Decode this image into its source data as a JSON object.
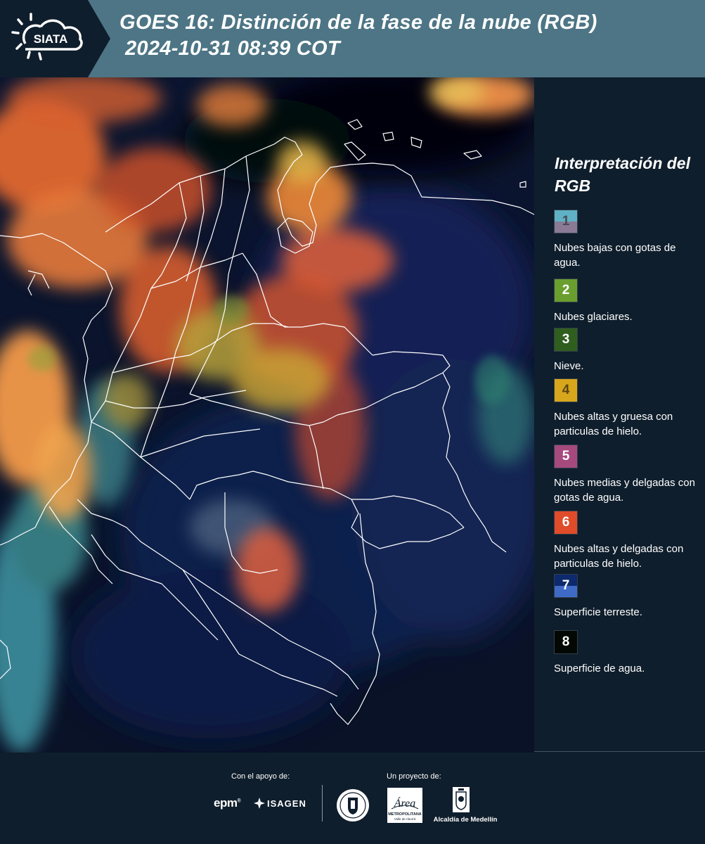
{
  "header": {
    "logo_text": "SIATA",
    "title_line1": "GOES 16: Distinción de la fase de la nube (RGB)",
    "title_line2": "2024-10-31 08:39 COT",
    "colors": {
      "bar": "#4d7585",
      "logo_bg": "#0f1e2c"
    }
  },
  "map": {
    "colors": {
      "ocean": "#0a1428",
      "borders": "#ffffff"
    }
  },
  "legend": {
    "title": "Interpretación del RGB",
    "items": [
      {
        "num": "1",
        "label": "Nubes bajas con gotas de agua.",
        "color_top": "#5fb2c5",
        "color_bottom": "#8a7a95",
        "num_color": "#4a4a55"
      },
      {
        "num": "2",
        "label": "Nubes glaciares.",
        "color_top": "#6a9e2e",
        "color_bottom": "#6a9e2e",
        "num_color": "#ffffff"
      },
      {
        "num": "3",
        "label": "Nieve.",
        "color_top": "#2f5e1f",
        "color_bottom": "#2f5e1f",
        "num_color": "#ffffff"
      },
      {
        "num": "4",
        "label": "Nubes altas y gruesa con particulas de hielo.",
        "color_top": "#d8a61d",
        "color_bottom": "#d8a61d",
        "num_color": "#5a4510"
      },
      {
        "num": "5",
        "label": "Nubes medias y delgadas con gotas de agua.",
        "color_top": "#a64a7e",
        "color_bottom": "#a64a7e",
        "num_color": "#ffffff"
      },
      {
        "num": "6",
        "label": "Nubes altas y delgadas con particulas de hielo.",
        "color_top": "#e04b2a",
        "color_bottom": "#e04b2a",
        "num_color": "#ffffff"
      },
      {
        "num": "7",
        "label": "Superficie terreste.",
        "color_top": "#0d2a6e",
        "color_bottom": "#3f6bc7",
        "num_color": "#ffffff"
      },
      {
        "num": "8",
        "label": "Superficie de agua.",
        "color_top": "#030805",
        "color_bottom": "#030805",
        "num_color": "#ffffff"
      }
    ]
  },
  "footer": {
    "support_label": "Con el apoyo de:",
    "project_label": "Un proyecto de:",
    "epm_logo": "epm",
    "isagen_logo": "ISAGEN",
    "amva_logo": "Área",
    "amva_sub1": "METROPOLITANA",
    "amva_sub2": "Valle de Aburrá",
    "alcaldia_logo": "Alcaldía de Medellín"
  }
}
